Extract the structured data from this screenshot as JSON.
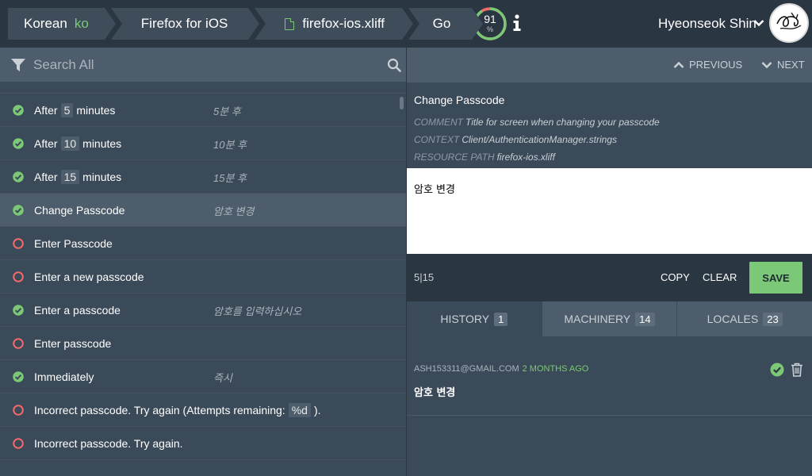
{
  "header": {
    "locale_name": "Korean",
    "locale_code": "ko",
    "project": "Firefox for iOS",
    "resource": "firefox-ios.xliff",
    "go_label": "Go",
    "progress_value": "91",
    "progress_unit": "%",
    "progress_fraction": 0.91,
    "user_name": "Hyeonseok Shin"
  },
  "search": {
    "placeholder": "Search All"
  },
  "list": [
    {
      "source_pre": "After",
      "placeholder": "5",
      "source_post": "minutes",
      "translation": "5분 후",
      "status": "approved"
    },
    {
      "source_pre": "After",
      "placeholder": "10",
      "source_post": "minutes",
      "translation": "10분 후",
      "status": "approved"
    },
    {
      "source_pre": "After",
      "placeholder": "15",
      "source_post": "minutes",
      "translation": "15분 후",
      "status": "approved"
    },
    {
      "source": "Change Passcode",
      "translation": "암호 변경",
      "status": "approved",
      "active": true
    },
    {
      "source": "Enter Passcode",
      "translation": "",
      "status": "missing"
    },
    {
      "source": "Enter a new passcode",
      "translation": "",
      "status": "missing"
    },
    {
      "source": "Enter a passcode",
      "translation": "암호를 입력하십시오",
      "status": "approved"
    },
    {
      "source": "Enter passcode",
      "translation": "",
      "status": "missing"
    },
    {
      "source": "Immediately",
      "translation": "즉시",
      "status": "approved"
    },
    {
      "source_pre": "Incorrect passcode. Try again (Attempts remaining:",
      "placeholder": "%d",
      "source_post": ").",
      "translation": "",
      "status": "missing"
    },
    {
      "source": "Incorrect passcode. Try again.",
      "translation": "",
      "status": "missing"
    }
  ],
  "nav": {
    "previous_label": "PREVIOUS",
    "next_label": "NEXT"
  },
  "entity": {
    "title": "Change Passcode",
    "comment_key": "COMMENT",
    "comment_value": "Title for screen when changing your passcode",
    "context_key": "CONTEXT",
    "context_value": "Client/AuthenticationManager.strings",
    "resource_key": "RESOURCE PATH",
    "resource_value": "firefox-ios.xliff"
  },
  "editor": {
    "value": "암호 변경",
    "counter": "5|15",
    "copy_label": "COPY",
    "clear_label": "CLEAR",
    "save_label": "SAVE"
  },
  "tabs": [
    {
      "label": "HISTORY",
      "count": "1"
    },
    {
      "label": "MACHINERY",
      "count": "14"
    },
    {
      "label": "LOCALES",
      "count": "23"
    }
  ],
  "history": {
    "user": "ASH153311@GMAIL.COM",
    "time": "2 MONTHS AGO",
    "translation": "암호 변경"
  },
  "colors": {
    "accent_green": "#7bc876",
    "missing_red": "#f36a6a",
    "header_bg": "#2a3641",
    "panel_bg": "#3b4a58"
  }
}
